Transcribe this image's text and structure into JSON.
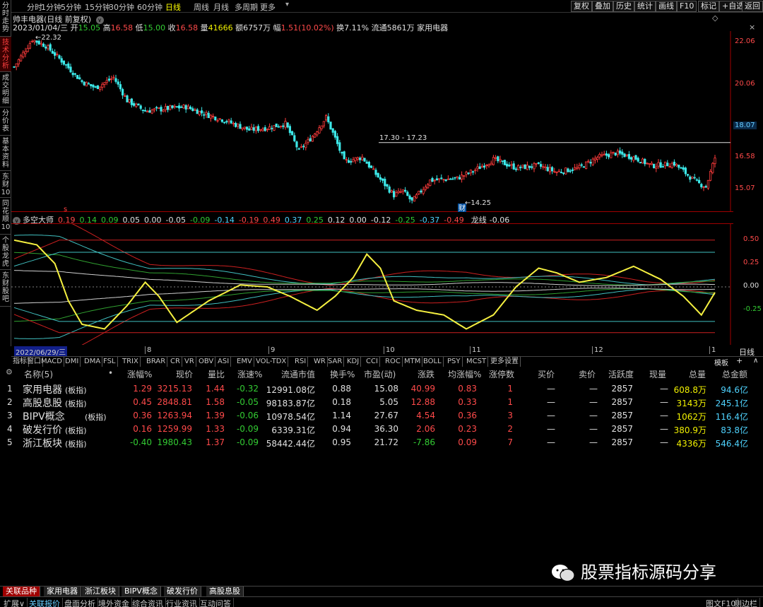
{
  "topbar": {
    "periods": [
      "分时",
      "1分钟",
      "5分钟",
      "15分钟",
      "30分钟",
      "60分钟",
      "日线",
      "周线",
      "月线",
      "多周期",
      "更多"
    ],
    "active_period": "日线",
    "right_buttons": [
      "复权",
      "叠加",
      "历史",
      "统计",
      "画线",
      "F10",
      "标记",
      "+自选",
      "返回"
    ]
  },
  "left_tabs": [
    "分时走势",
    "技术分析",
    "成交明细",
    "分价表",
    "基本资料",
    "东财10",
    "同花顺10",
    "个股龙虎",
    "东财股吧"
  ],
  "stock": {
    "title": "帅丰电器(日线 前复权)",
    "date": "2023/01/04/三",
    "open_label": "开",
    "open": "15.05",
    "high_label": "高",
    "high": "16.58",
    "low_label": "低",
    "low": "15.00",
    "close_label": "收",
    "close": "16.58",
    "vol_label": "量",
    "vol": "41666",
    "amount_label": "额",
    "amount": "6757万",
    "change_label": "幅",
    "change": "1.51(10.02%)",
    "turnover_label": "换",
    "turnover": "7.11%",
    "float_label": "流通",
    "float": "5861万",
    "industry": "家用电器"
  },
  "candle_chart": {
    "price_ticks": [
      "22.06",
      "20.06",
      "18.07",
      "16.58",
      "15.07"
    ],
    "price_range": [
      14.0,
      22.6
    ],
    "hi_label": "22.32",
    "lo_label": "14.25",
    "hline_label": "17.30 - 17.23",
    "hline_value": 17.3,
    "current_tag": "18.07",
    "fin_badge": "财",
    "s_badge": "s"
  },
  "osc_chart": {
    "title": "多空大师",
    "values": [
      {
        "v": "0.19",
        "c": "red"
      },
      {
        "v": "0.14",
        "c": "green"
      },
      {
        "v": "0.09",
        "c": "green"
      },
      {
        "v": "0.05",
        "c": "white"
      },
      {
        "v": "0.00",
        "c": "white"
      },
      {
        "v": "-0.05",
        "c": "white"
      },
      {
        "v": "-0.09",
        "c": "green"
      },
      {
        "v": "-0.14",
        "c": "cyan"
      },
      {
        "v": "-0.19",
        "c": "red"
      },
      {
        "v": "0.49",
        "c": "red"
      },
      {
        "v": "0.37",
        "c": "cyan"
      },
      {
        "v": "0.25",
        "c": "green"
      },
      {
        "v": "0.12",
        "c": "white"
      },
      {
        "v": "0.00",
        "c": "white"
      },
      {
        "v": "-0.12",
        "c": "white"
      },
      {
        "v": "-0.25",
        "c": "green"
      },
      {
        "v": "-0.37",
        "c": "cyan"
      },
      {
        "v": "-0.49",
        "c": "red"
      }
    ],
    "dragon_label": "龙线",
    "dragon_value": "-0.06",
    "ticks": [
      "0.50",
      "0.25",
      "0.00",
      "-0.25"
    ],
    "range": [
      -0.62,
      0.68
    ]
  },
  "time_axis": {
    "start_date": "2022/06/29/三",
    "months": [
      "8",
      "9",
      "10",
      "11",
      "12",
      "1"
    ],
    "period_label": "日线"
  },
  "indicator_tabs": [
    "指标",
    "窗口",
    "MACD",
    "DMI",
    "DMA",
    "FSL",
    "TRIX",
    "BRAR",
    "CR",
    "VR",
    "OBV",
    "ASI",
    "EMV",
    "VOL-TDX",
    "RSI",
    "WR",
    "SAR",
    "KDJ",
    "CCI",
    "ROC",
    "MTM",
    "BOLL",
    "PSY",
    "MCST",
    "更多",
    "设置"
  ],
  "template_label": "模板",
  "table": {
    "headers": [
      "名称(5)",
      "•",
      "涨幅%",
      "现价",
      "量比",
      "涨速%",
      "流通市值",
      "换手%",
      "市盈(动)",
      "涨跌",
      "均涨幅%",
      "涨停数",
      "买价",
      "卖价",
      "活跃度",
      "现量",
      "总量",
      "总金额"
    ],
    "rows": [
      {
        "idx": "1",
        "name": "家用电器",
        "tag": "(板指)",
        "chg": "1.29",
        "price": "3215.13",
        "vr": "1.44",
        "speed": "-0.32",
        "mcap": "12991.08亿",
        "turn": "0.88",
        "pe": "15.08",
        "diff": "40.99",
        "avg": "0.83",
        "limit": "1",
        "bid": "—",
        "ask": "—",
        "act": "2857",
        "cur": "—",
        "vol": "608.8万",
        "amt": "94.6亿",
        "up": true,
        "sp_up": false
      },
      {
        "idx": "2",
        "name": "高股息股",
        "tag": "(板指)",
        "chg": "0.45",
        "price": "2848.81",
        "vr": "1.58",
        "speed": "-0.05",
        "mcap": "98183.87亿",
        "turn": "0.18",
        "pe": "5.05",
        "diff": "12.88",
        "avg": "0.33",
        "limit": "1",
        "bid": "—",
        "ask": "—",
        "act": "2857",
        "cur": "—",
        "vol": "3143万",
        "amt": "245.1亿",
        "up": true,
        "sp_up": false
      },
      {
        "idx": "3",
        "name": "BIPV概念",
        "tag": "(板指)",
        "chg": "0.36",
        "price": "1263.94",
        "vr": "1.39",
        "speed": "-0.06",
        "mcap": "10978.54亿",
        "turn": "1.14",
        "pe": "27.67",
        "diff": "4.54",
        "avg": "0.36",
        "limit": "3",
        "bid": "—",
        "ask": "—",
        "act": "2857",
        "cur": "—",
        "vol": "1062万",
        "amt": "116.4亿",
        "up": true,
        "sp_up": false
      },
      {
        "idx": "4",
        "name": "破发行价",
        "tag": "(板指)",
        "chg": "0.16",
        "price": "1259.99",
        "vr": "1.33",
        "speed": "-0.09",
        "mcap": "6339.31亿",
        "turn": "0.94",
        "pe": "36.30",
        "diff": "2.06",
        "avg": "0.23",
        "limit": "2",
        "bid": "—",
        "ask": "—",
        "act": "2857",
        "cur": "—",
        "vol": "380.9万",
        "amt": "83.8亿",
        "up": true,
        "sp_up": false
      },
      {
        "idx": "5",
        "name": "浙江板块",
        "tag": "(板指)",
        "chg": "-0.40",
        "price": "1980.43",
        "vr": "1.37",
        "speed": "-0.09",
        "mcap": "58442.44亿",
        "turn": "0.95",
        "pe": "21.72",
        "diff": "-7.86",
        "avg": "0.09",
        "limit": "7",
        "bid": "—",
        "ask": "—",
        "act": "2857",
        "cur": "—",
        "vol": "4336万",
        "amt": "546.4亿",
        "up": false,
        "sp_up": false
      }
    ]
  },
  "sheet_tabs": [
    "关联品种",
    "家用电器",
    "浙江板块",
    "BIPV概念",
    "破发行价",
    "高股息股"
  ],
  "status_items": [
    "扩展∨",
    "关联报价",
    "盘面分析",
    "境外资金",
    "综合资讯",
    "行业资讯",
    "互动问答"
  ],
  "status_right": [
    "图文F10",
    "侧边栏"
  ],
  "watermark": "股票指标源码分享",
  "colors": {
    "up": "#ff3b3b",
    "down": "#3ce8e8",
    "dragon": "#f5f040",
    "ma": "#cfcfcf"
  }
}
